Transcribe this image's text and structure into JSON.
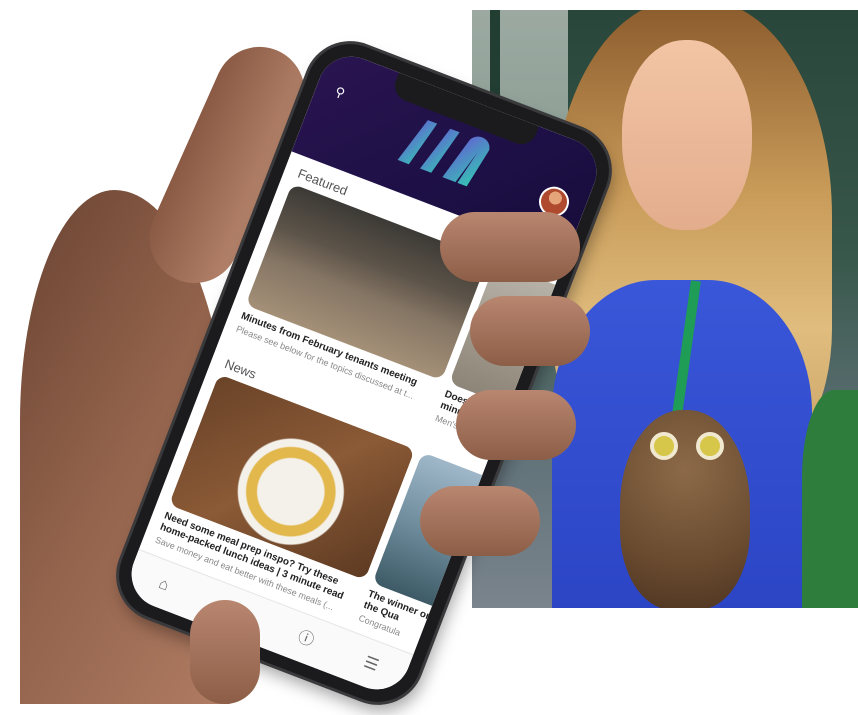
{
  "app": {
    "sections": {
      "featured": "Featured",
      "news": "News"
    },
    "featured_cards": [
      {
        "title": "Minutes from February tenants meeting",
        "desc": "Please see below for the topics discussed at t..."
      },
      {
        "title": "Does icing minute rea",
        "desc": "Men's Healt"
      }
    ],
    "news_cards": [
      {
        "title": "Need some meal prep inspo? Try these home-packed lunch ideas | 3 minute read",
        "desc": "Save money and eat better with these meals (..."
      },
      {
        "title": "The winner on the Qua",
        "desc": "Congratula"
      }
    ],
    "icons": {
      "search": "search-icon",
      "avatar": "avatar",
      "tabs": [
        "home-icon",
        "news-icon",
        "info-icon",
        "menu-icon"
      ]
    },
    "colors": {
      "header": "#1d1046",
      "logo_gradient_start": "#6b4fd8",
      "logo_gradient_end": "#2fd0b0"
    }
  }
}
